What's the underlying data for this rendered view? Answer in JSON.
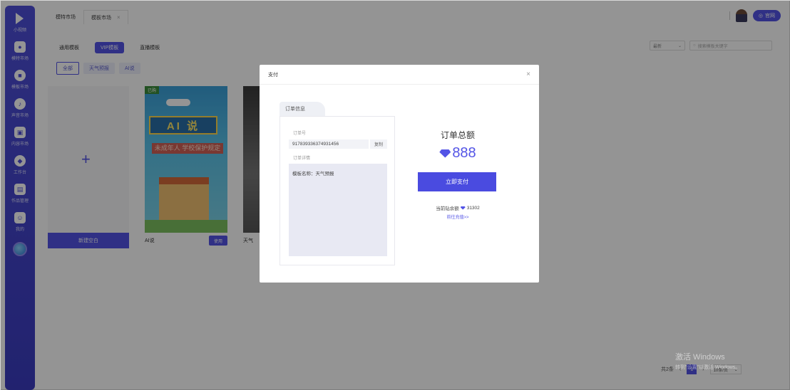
{
  "sidebar": {
    "logo_text": "小视频",
    "items": [
      {
        "label": "模特市场",
        "icon": "user-icon"
      },
      {
        "label": "模板市场",
        "icon": "template-icon"
      },
      {
        "label": "声音市场",
        "icon": "sound-icon"
      },
      {
        "label": "内容市场",
        "icon": "content-icon"
      },
      {
        "label": "工作台",
        "icon": "workbench-icon"
      },
      {
        "label": "作品管理",
        "icon": "works-icon"
      },
      {
        "label": "我的",
        "icon": "profile-icon"
      }
    ]
  },
  "topbar": {
    "tabs": [
      {
        "label": "模特市场"
      },
      {
        "label": "模板市场",
        "closable": true
      }
    ],
    "official_button": "官网"
  },
  "filters": {
    "categories": [
      "通用模板",
      "VIP模板",
      "直播模板"
    ],
    "active_category": "VIP模板",
    "chips": [
      "全部",
      "天气预报",
      "AI说"
    ],
    "active_chip": "全部",
    "sort_select": "最新",
    "search_placeholder": "搜索模板关键字"
  },
  "cards": {
    "blank_label": "新建空白",
    "ai_card": {
      "badge": "已购",
      "poster_title": "AI 说",
      "poster_sub": "未成年人 学校保护规定",
      "name": "AI说",
      "use_button": "使用"
    },
    "weather_card": {
      "name": "天气"
    }
  },
  "modal": {
    "title": "支付",
    "order_tab": "订单信息",
    "order_no_label": "订单号",
    "order_no": "917839336374931456",
    "copy_button": "复制",
    "detail_label": "订单详情",
    "detail_text": "模板名称：天气预报",
    "total_title": "订单总额",
    "total_amount": "888",
    "pay_button": "立即支付",
    "balance_text": "当前钻余额",
    "balance_value": "31302",
    "open_link": "前往充值>>"
  },
  "pagination": {
    "total_text": "共2条",
    "current_page": "1",
    "page_size": "10条/页"
  },
  "watermark": {
    "line1": "激活 Windows",
    "line2": "转到\"设置\"以激活 Windows。"
  },
  "colors": {
    "accent": "#5354e6",
    "sidebar": "#4e4fd8"
  }
}
